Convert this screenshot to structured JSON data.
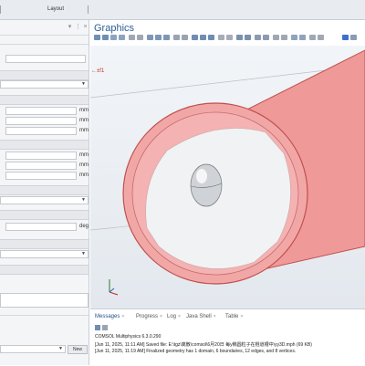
{
  "topbar": {
    "layout_label": "Layout"
  },
  "graphics": {
    "title": "Graphics",
    "xyz_label": "←±f1"
  },
  "settings": {
    "units": {
      "mm": "mm",
      "deg": "deg"
    },
    "new_button": "New"
  },
  "messages": {
    "tabs": [
      "Messages",
      "Progress",
      "Log",
      "Java Shell",
      "Table"
    ],
    "lines": [
      "COMSOL Multiphysics 6.3.0.290",
      "[Jun 11, 2025, 11:11 AM] Saved file: E:\\tgz\\离散\\comsol\\6月20日 每y椭圆粒子在棍道槽中\\yy3D.mph (69 KB)",
      "[Jun 11, 2025, 11:19 AM] Finalized geometry has 1 domain, 6 boundaries, 12 edges, and 8 vertices."
    ]
  },
  "colors": {
    "accent": "#2c5f99",
    "pipe_fill": "#ec8f8f",
    "pipe_edge": "#c0504d"
  }
}
